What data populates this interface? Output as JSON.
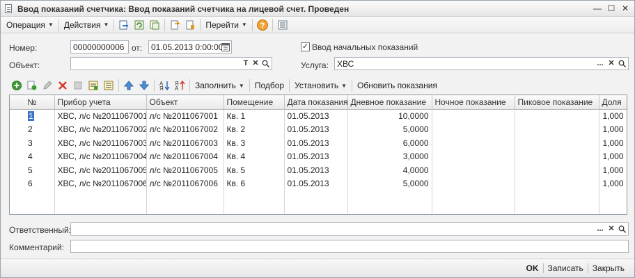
{
  "window": {
    "title": "Ввод показаний счетчика: Ввод показаний счетчика на лицевой счет. Проведен",
    "btn_min": "—",
    "btn_max": "☐",
    "btn_close": "✕"
  },
  "cmdbar": {
    "operation": "Операция",
    "actions": "Действия",
    "goto": "Перейти",
    "help_icon": "?"
  },
  "form": {
    "number_label": "Номер:",
    "number_value": "00000000006",
    "date_label": "от:",
    "date_value": "01.05.2013  0:00:00",
    "initial_checkbox_label": "Ввод начальных показаний",
    "initial_checked": "✓",
    "object_label": "Объект:",
    "object_value": "",
    "object_btn_t": "T",
    "object_btn_x": "✕",
    "service_label": "Услуга:",
    "service_value": "ХВС",
    "service_btn_dots": "...",
    "service_btn_x": "✕",
    "responsible_label": "Ответственный:",
    "responsible_value": "",
    "comment_label": "Комментарий:",
    "comment_value": ""
  },
  "table_toolbar": {
    "fill": "Заполнить",
    "pick": "Подбор",
    "set": "Установить",
    "update": "Обновить показания"
  },
  "table": {
    "columns": [
      "№",
      "Прибор учета",
      "Объект",
      "Помещение",
      "Дата показания",
      "Дневное показание",
      "Ночное показание",
      "Пиковое показание",
      "Доля"
    ],
    "rows": [
      {
        "num": "1",
        "device": "ХВС, л/с №2011067001",
        "object": "л/с №2011067001",
        "room": "Кв. 1",
        "date": "01.05.2013",
        "day": "10,0000",
        "night": "",
        "peak": "",
        "share": "1,000"
      },
      {
        "num": "2",
        "device": "ХВС, л/с №2011067002",
        "object": "л/с №2011067002",
        "room": "Кв. 2",
        "date": "01.05.2013",
        "day": "5,0000",
        "night": "",
        "peak": "",
        "share": "1,000"
      },
      {
        "num": "3",
        "device": "ХВС, л/с №2011067003",
        "object": "л/с №2011067003",
        "room": "Кв. 3",
        "date": "01.05.2013",
        "day": "6,0000",
        "night": "",
        "peak": "",
        "share": "1,000"
      },
      {
        "num": "4",
        "device": "ХВС, л/с №2011067004",
        "object": "л/с №2011067004",
        "room": "Кв. 4",
        "date": "01.05.2013",
        "day": "3,0000",
        "night": "",
        "peak": "",
        "share": "1,000"
      },
      {
        "num": "5",
        "device": "ХВС, л/с №2011067005",
        "object": "л/с №2011067005",
        "room": "Кв. 5",
        "date": "01.05.2013",
        "day": "4,0000",
        "night": "",
        "peak": "",
        "share": "1,000"
      },
      {
        "num": "6",
        "device": "ХВС, л/с №2011067006",
        "object": "л/с №2011067006",
        "room": "Кв. 6",
        "date": "01.05.2013",
        "day": "5,0000",
        "night": "",
        "peak": "",
        "share": "1,000"
      }
    ]
  },
  "bottombar": {
    "ok": "OK",
    "save": "Записать",
    "close": "Закрыть"
  }
}
